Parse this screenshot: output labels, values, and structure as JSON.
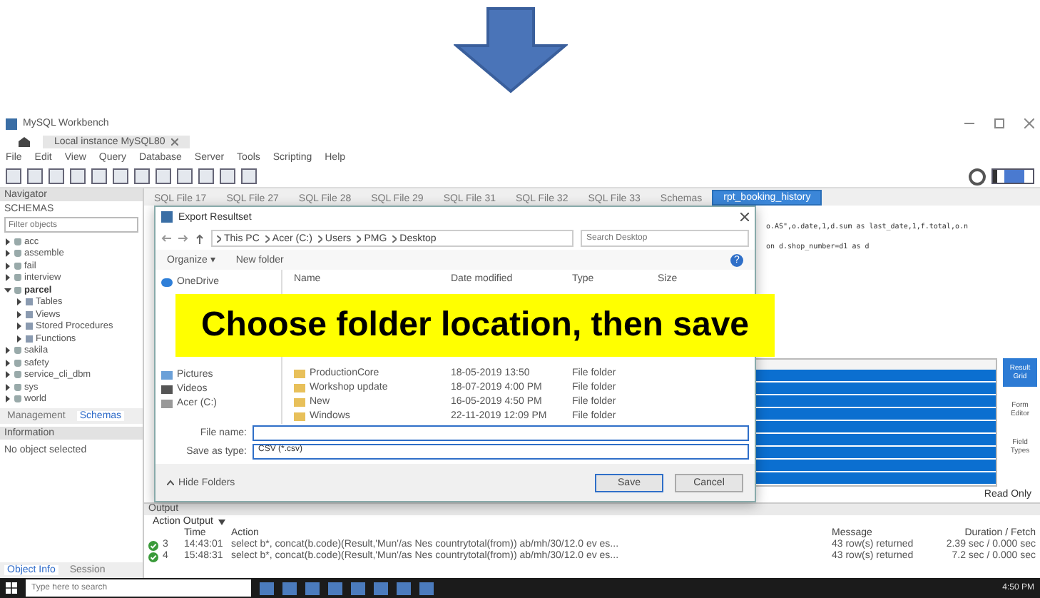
{
  "callout": {
    "text": "Choose folder location, then save"
  },
  "window": {
    "title": "MySQL Workbench",
    "connection_tab": "Local instance MySQL80"
  },
  "menu": [
    "File",
    "Edit",
    "View",
    "Query",
    "Database",
    "Server",
    "Tools",
    "Scripting",
    "Help"
  ],
  "navigator": {
    "title": "Navigator",
    "schemas_label": "SCHEMAS",
    "filter_placeholder": "Filter objects",
    "tree": [
      {
        "label": "acc",
        "expanded": false
      },
      {
        "label": "assemble",
        "expanded": false
      },
      {
        "label": "fail",
        "expanded": false
      },
      {
        "label": "interview",
        "expanded": false
      },
      {
        "label": "parcel",
        "expanded": true,
        "children": [
          {
            "label": "Tables"
          },
          {
            "label": "Views"
          },
          {
            "label": "Stored Procedures"
          },
          {
            "label": "Functions"
          }
        ]
      },
      {
        "label": "sakila",
        "expanded": false
      },
      {
        "label": "safety",
        "expanded": false
      },
      {
        "label": "service_cli_dbm",
        "expanded": false
      },
      {
        "label": "sys",
        "expanded": false
      },
      {
        "label": "world",
        "expanded": false
      }
    ],
    "tabs": [
      {
        "label": "Management",
        "selected": false
      },
      {
        "label": "Schemas",
        "selected": true
      }
    ],
    "info_title": "Information",
    "info_text": "No object selected",
    "bottom_tabs": [
      {
        "label": "Object Info",
        "selected": true
      },
      {
        "label": "Session",
        "selected": false
      }
    ]
  },
  "sql_tabs": [
    {
      "label": "SQL File 17",
      "selected": false
    },
    {
      "label": "SQL File 27",
      "selected": false
    },
    {
      "label": "SQL File 28",
      "selected": false
    },
    {
      "label": "SQL File 29",
      "selected": false
    },
    {
      "label": "SQL File 31",
      "selected": false
    },
    {
      "label": "SQL File 32",
      "selected": false
    },
    {
      "label": "SQL File 33",
      "selected": false
    },
    {
      "label": "Schemas",
      "selected": false
    },
    {
      "label": "rpt_booking_history",
      "selected": true
    }
  ],
  "editor_lines": [
    "o.AS\",o.date,1,d.sum as last_date,1,f.total,o.n",
    "on d.shop_number=d1 as d"
  ],
  "result_rows": [
    {
      "selected": true
    },
    {
      "selected": true
    },
    {
      "selected": true
    },
    {
      "selected": true
    },
    {
      "selected": true
    },
    {
      "selected": true
    },
    {
      "selected": true
    },
    {
      "selected": true
    },
    {
      "selected": true
    }
  ],
  "side_panel": [
    {
      "label": "Result Grid",
      "selected": true
    },
    {
      "label": "Form Editor",
      "selected": false
    },
    {
      "label": "Field Types",
      "selected": false
    }
  ],
  "read_only": "Read Only",
  "output": {
    "title": "Output",
    "selector": "Action Output",
    "columns": [
      "Time",
      "Action",
      "Message",
      "Duration / Fetch"
    ],
    "rows": [
      {
        "ok": true,
        "num": "3",
        "time": "14:43:01",
        "action": "select b*, concat(b.code)(Result,'Mun'/as Nes countrytotal(from)) ab/mh/30/12.0 ev es...",
        "message": "43 row(s) returned",
        "duration": "2.39 sec / 0.000 sec"
      },
      {
        "ok": true,
        "num": "4",
        "time": "15:48:31",
        "action": "select b*, concat(b.code)(Result,'Mun'/as Nes countrytotal(from)) ab/mh/30/12.0 ev es...",
        "message": "43 row(s) returned",
        "duration": "7.2 sec / 0.000 sec"
      }
    ]
  },
  "dialog": {
    "title": "Export Resultset",
    "path": [
      "This PC",
      "Acer (C:)",
      "Users",
      "PMG",
      "Desktop"
    ],
    "search_placeholder": "Search Desktop",
    "organize": "Organize ▾",
    "new_folder": "New folder",
    "help": "?",
    "nav": [
      {
        "label": "OneDrive",
        "kind": "cloud"
      },
      {
        "label": "Pictures",
        "kind": "pictures"
      },
      {
        "label": "Videos",
        "kind": "videos"
      },
      {
        "label": "Acer (C:)",
        "kind": "drive"
      }
    ],
    "columns": [
      "Name",
      "Date modified",
      "Type",
      "Size"
    ],
    "files": [
      {
        "name": "ProductionCore",
        "date": "18-05-2019 13:50",
        "type": "File folder"
      },
      {
        "name": "Workshop update",
        "date": "18-07-2019 4:00 PM",
        "type": "File folder"
      },
      {
        "name": "New",
        "date": "16-05-2019 4:50 PM",
        "type": "File folder"
      },
      {
        "name": "Windows",
        "date": "22-11-2019 12:09 PM",
        "type": "File folder"
      }
    ],
    "file_name_label": "File name:",
    "save_type_label": "Save as type:",
    "save_type": "CSV (*.csv)",
    "hide_folders": "Hide Folders",
    "save": "Save",
    "cancel": "Cancel"
  },
  "taskbar": {
    "search_placeholder": "Type here to search",
    "time": "4:50 PM"
  }
}
